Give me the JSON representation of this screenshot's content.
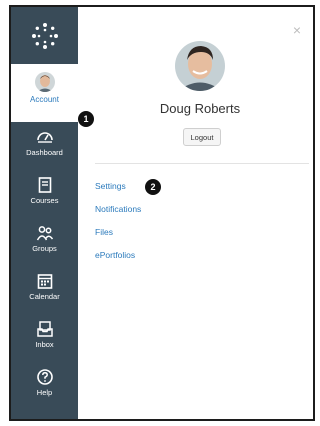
{
  "nav": {
    "account": {
      "label": "Account",
      "marker": "1"
    },
    "items": [
      {
        "label": "Dashboard",
        "icon": "dashboard-icon"
      },
      {
        "label": "Courses",
        "icon": "courses-icon"
      },
      {
        "label": "Groups",
        "icon": "groups-icon"
      },
      {
        "label": "Calendar",
        "icon": "calendar-icon"
      },
      {
        "label": "Inbox",
        "icon": "inbox-icon"
      },
      {
        "label": "Help",
        "icon": "help-icon"
      }
    ]
  },
  "tray": {
    "user_name": "Doug Roberts",
    "logout_label": "Logout",
    "close_glyph": "×",
    "links": [
      {
        "label": "Settings",
        "marker": "2"
      },
      {
        "label": "Notifications"
      },
      {
        "label": "Files"
      },
      {
        "label": "ePortfolios"
      }
    ]
  },
  "colors": {
    "nav_bg": "#394b58",
    "link": "#2b7abc",
    "marker": "#111111"
  }
}
